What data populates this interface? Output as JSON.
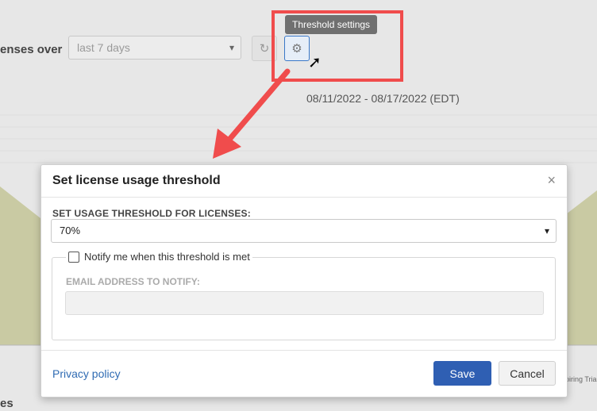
{
  "background": {
    "label": "enses over",
    "period_value": "last 7 days",
    "refresh_icon": "refresh-icon",
    "gear_icon": "gear-icon",
    "tooltip": "Threshold settings",
    "date_range": "08/11/2022 - 08/17/2022 (EDT)",
    "footer_label": "es",
    "legend_fragment": "piring Tria"
  },
  "modal": {
    "title": "Set license usage threshold",
    "close_icon": "close-icon",
    "threshold_label": "SET USAGE THRESHOLD FOR LICENSES:",
    "threshold_value": "70%",
    "notify_label": "Notify me when this threshold is met",
    "notify_checked": false,
    "email_label": "EMAIL ADDRESS TO NOTIFY:",
    "email_value": "",
    "privacy_link": "Privacy policy",
    "save_label": "Save",
    "cancel_label": "Cancel"
  },
  "colors": {
    "annotation": "#f04c4c",
    "primary": "#2f5fb3",
    "link": "#2f6bb3",
    "chart_fill": "#c9caa3"
  }
}
